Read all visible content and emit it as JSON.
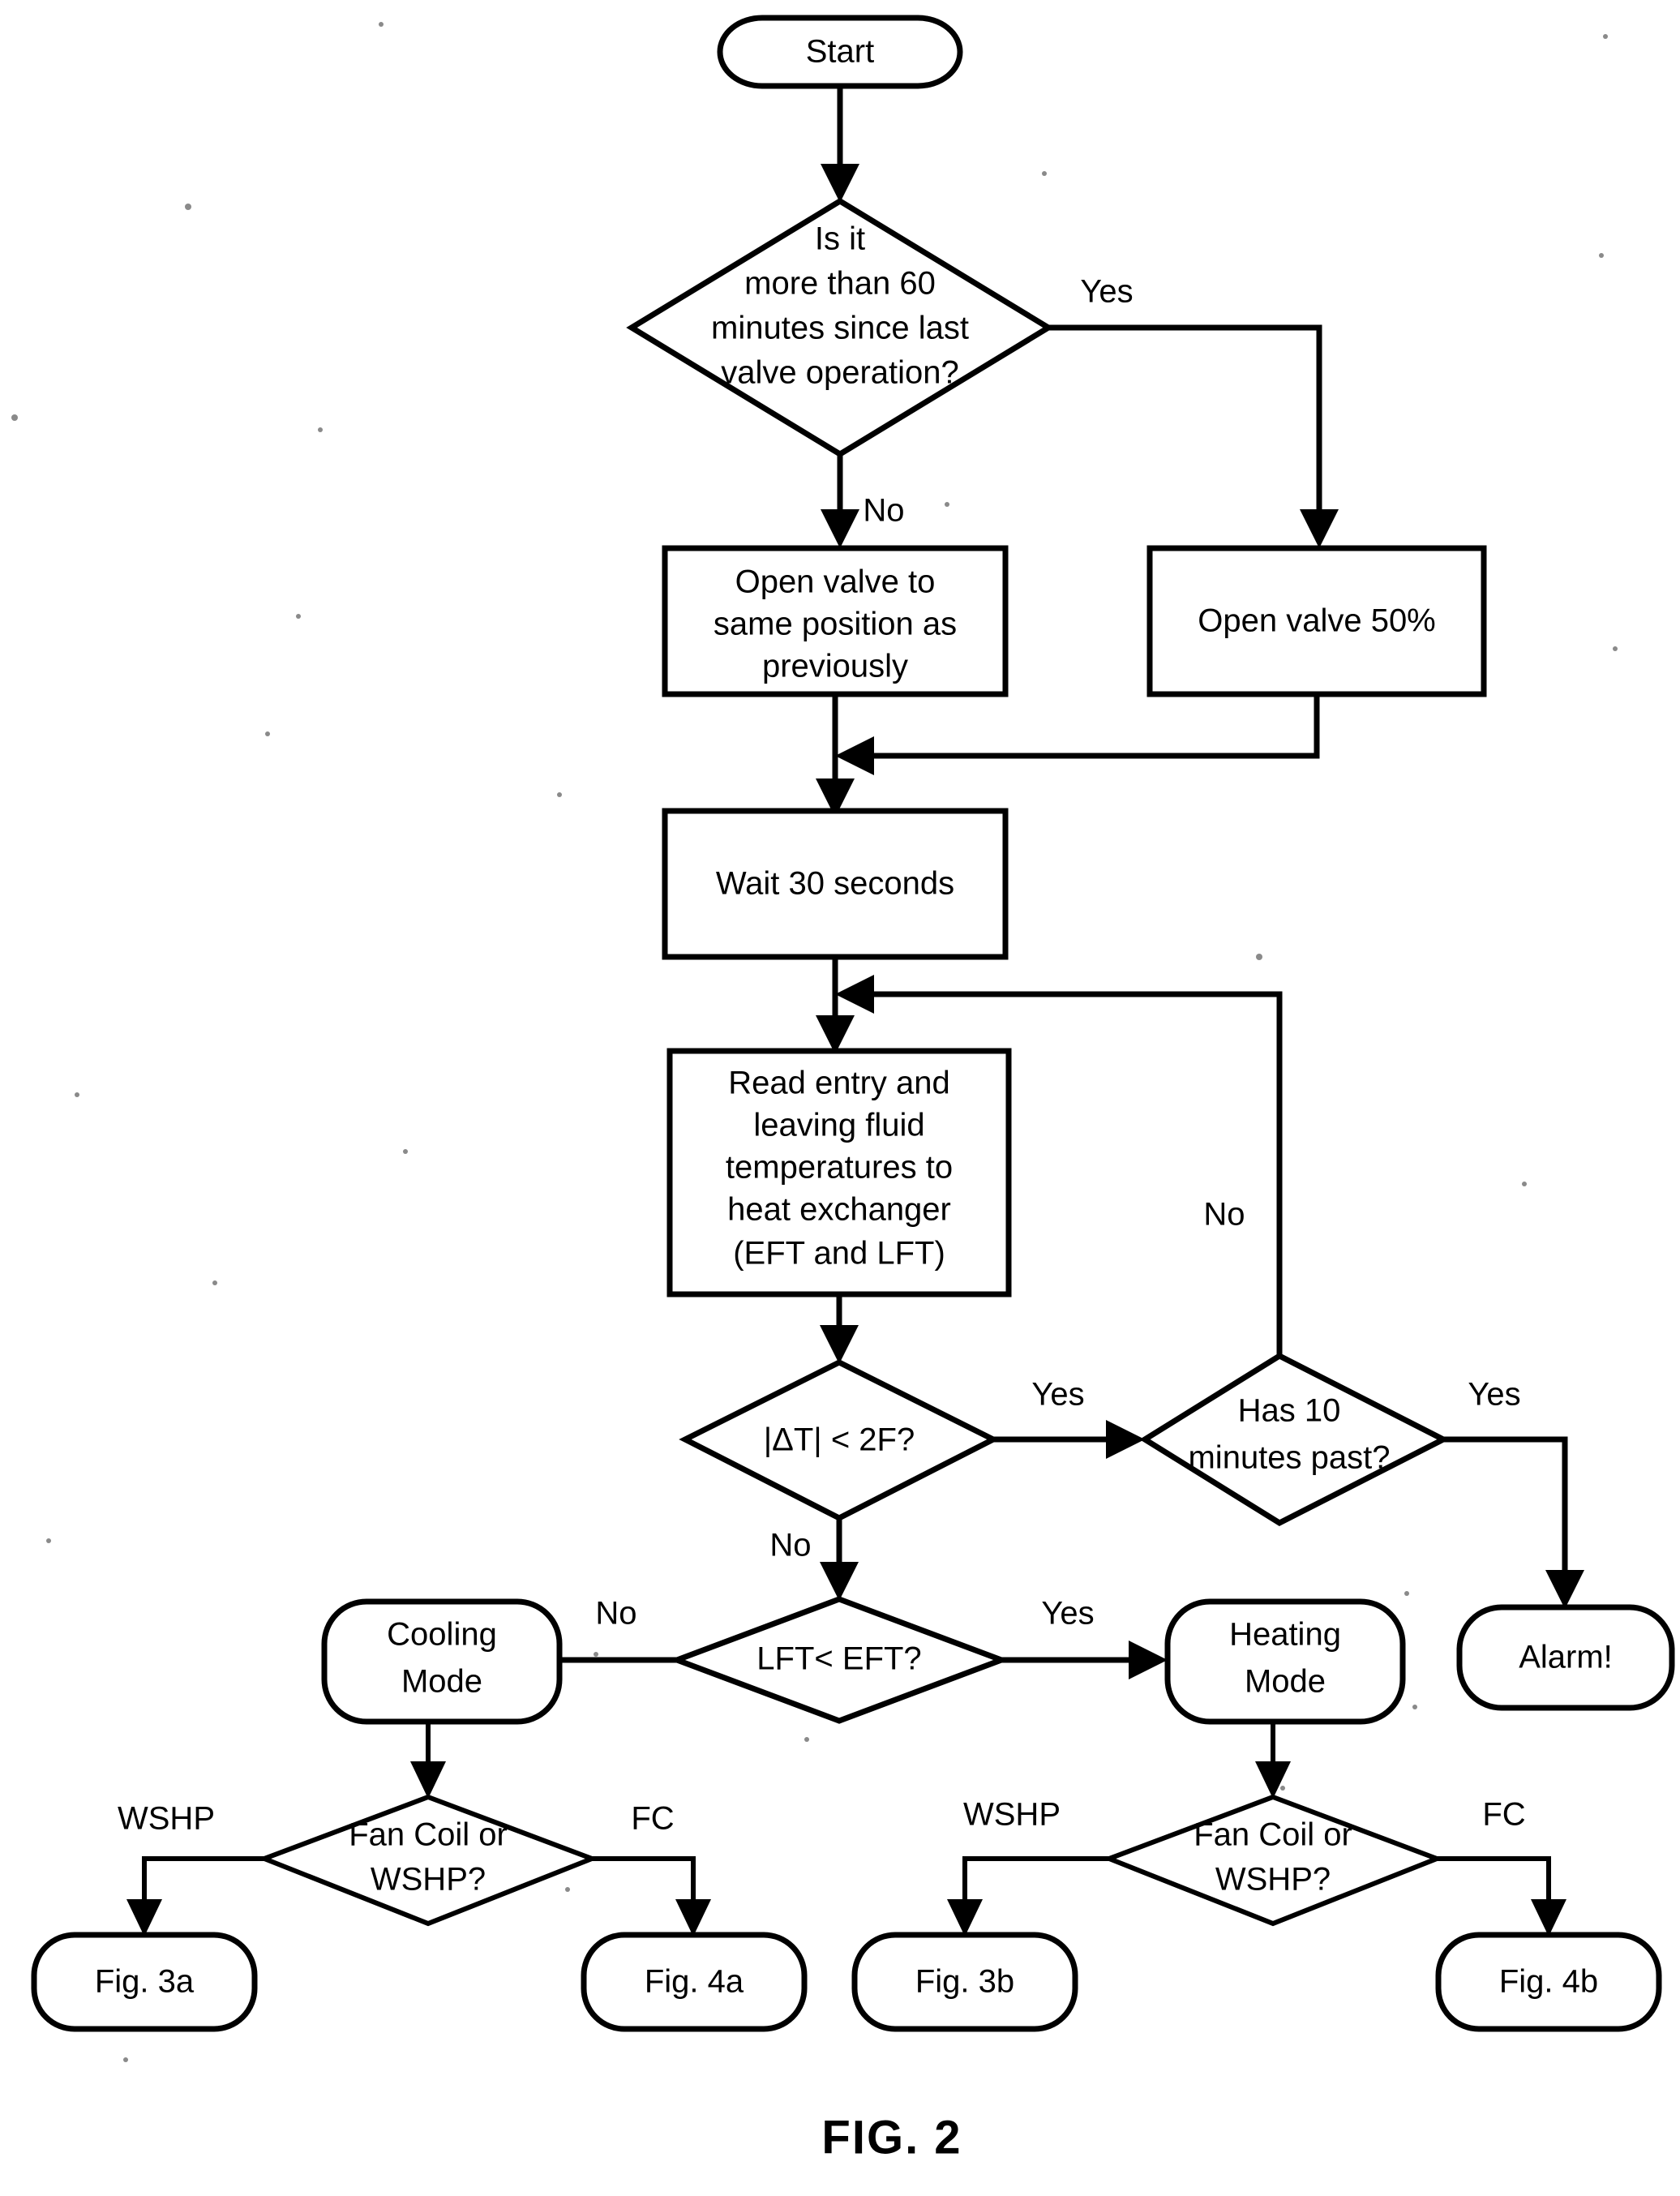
{
  "figure": {
    "caption": "FIG. 2",
    "type": "flowchart",
    "title": "Valve control logic flowchart"
  },
  "nodes": {
    "start": {
      "label": "Start",
      "shape": "terminator"
    },
    "check_60_min": {
      "line1": "Is it",
      "line2": "more than 60",
      "line3": "minutes since last",
      "line4": "valve operation?",
      "shape": "decision"
    },
    "open_valve_same": {
      "line1": "Open valve to",
      "line2": "same position as",
      "line3": "previously",
      "shape": "process"
    },
    "open_valve_50": {
      "label": "Open valve 50%",
      "shape": "process"
    },
    "wait_30_seconds": {
      "label": "Wait 30 seconds",
      "shape": "process"
    },
    "read_temps": {
      "line1": "Read entry and",
      "line2": "leaving fluid",
      "line3": "temperatures to",
      "line4": "heat exchanger",
      "line5": "(EFT and LFT)",
      "shape": "process"
    },
    "delta_t_check": {
      "label": "|ΔT| < 2F?",
      "shape": "decision"
    },
    "has_10_min": {
      "line1": "Has 10",
      "line2": "minutes past?",
      "shape": "decision"
    },
    "alarm": {
      "label": "Alarm!",
      "shape": "terminator"
    },
    "lft_lt_eft": {
      "label": "LFT< EFT?",
      "shape": "decision"
    },
    "cooling_mode": {
      "line1": "Cooling",
      "line2": "Mode",
      "shape": "terminator"
    },
    "heating_mode": {
      "line1": "Heating",
      "line2": "Mode",
      "shape": "terminator"
    },
    "fan_coil_or_wshp_cooling": {
      "line1": "Fan Coil or",
      "line2": "WSHP?",
      "shape": "decision"
    },
    "fan_coil_or_wshp_heating": {
      "line1": "Fan Coil or",
      "line2": "WSHP?",
      "shape": "decision"
    },
    "fig_3a": {
      "label": "Fig. 3a",
      "shape": "terminator"
    },
    "fig_4a": {
      "label": "Fig. 4a",
      "shape": "terminator"
    },
    "fig_3b": {
      "label": "Fig. 3b",
      "shape": "terminator"
    },
    "fig_4b": {
      "label": "Fig. 4b",
      "shape": "terminator"
    }
  },
  "edge_labels": {
    "check60_yes": "Yes",
    "check60_no": "No",
    "delta_yes": "Yes",
    "delta_no": "No",
    "has10_yes": "Yes",
    "has10_no": "No",
    "lft_no": "No",
    "lft_yes": "Yes",
    "cooling_wshp": "WSHP",
    "cooling_fc": "FC",
    "heating_wshp": "WSHP",
    "heating_fc": "FC"
  },
  "colors": {
    "stroke": "#000000",
    "fill": "#ffffff",
    "background": "#ffffff"
  }
}
